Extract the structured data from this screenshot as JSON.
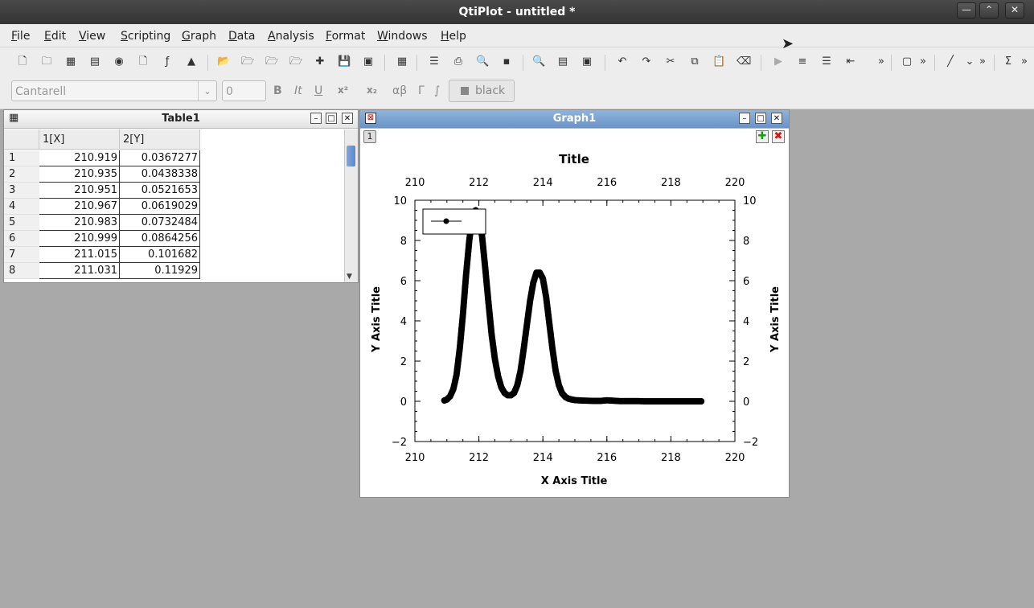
{
  "app": {
    "window_title": "QtiPlot - untitled *",
    "wm_buttons": [
      "—",
      "⌃",
      "✕"
    ]
  },
  "menu": [
    {
      "label": "File",
      "underline": "F",
      "rest": "ile"
    },
    {
      "label": "Edit",
      "underline": "E",
      "rest": "dit"
    },
    {
      "label": "View",
      "underline": "V",
      "rest": "iew"
    },
    {
      "label": "Scripting",
      "underline": "S",
      "rest": "cripting"
    },
    {
      "label": "Graph",
      "underline": "G",
      "rest": "raph"
    },
    {
      "label": "Data",
      "underline": "D",
      "rest": "ata"
    },
    {
      "label": "Analysis",
      "underline": "A",
      "rest": "nalysis"
    },
    {
      "label": "Format",
      "underline": "F",
      "rest": "ormat"
    },
    {
      "label": "Windows",
      "underline": "W",
      "rest": "indows"
    },
    {
      "label": "Help",
      "underline": "H",
      "rest": "elp"
    }
  ],
  "toolbar": {
    "overflow_labels": [
      "»",
      "»",
      "»",
      "»"
    ],
    "sigma": "Σ"
  },
  "format_toolbar": {
    "font_family": "Cantarell",
    "font_size": "0",
    "bold": "B",
    "italic": "It",
    "underline": "U",
    "superscript": "x²",
    "subscript": "x₂",
    "greek": "αβ",
    "greek_upper": "Γ",
    "integral": "∫",
    "color_label": "black"
  },
  "table_window": {
    "title": "Table1",
    "columns": [
      "1[X]",
      "2[Y]"
    ],
    "rows": [
      {
        "n": "1",
        "x": "210.919",
        "y": "0.0367277"
      },
      {
        "n": "2",
        "x": "210.935",
        "y": "0.0438338"
      },
      {
        "n": "3",
        "x": "210.951",
        "y": "0.0521653"
      },
      {
        "n": "4",
        "x": "210.967",
        "y": "0.0619029"
      },
      {
        "n": "5",
        "x": "210.983",
        "y": "0.0732484"
      },
      {
        "n": "6",
        "x": "210.999",
        "y": "0.0864256"
      },
      {
        "n": "7",
        "x": "211.015",
        "y": "0.101682"
      },
      {
        "n": "8",
        "x": "211.031",
        "y": "0.11929"
      }
    ]
  },
  "graph_window": {
    "title": "Graph1",
    "layer_label": "1"
  },
  "chart_data": {
    "type": "scatter",
    "title": "Title",
    "xlabel": "X Axis Title",
    "ylabel": "Y Axis Title",
    "right_ylabel": "Y Axis Title",
    "xlim": [
      210,
      220
    ],
    "ylim": [
      -2,
      10
    ],
    "xticks": [
      210,
      212,
      214,
      216,
      218,
      220
    ],
    "yticks": [
      -2,
      0,
      2,
      4,
      6,
      8,
      10
    ],
    "ytick_labels": [
      "−2",
      "0",
      "2",
      "4",
      "6",
      "8",
      "10"
    ],
    "grid": false,
    "legend": "top-left",
    "color": "#000000",
    "x": [
      210.92,
      211.0,
      211.1,
      211.2,
      211.3,
      211.4,
      211.5,
      211.6,
      211.7,
      211.8,
      211.9,
      212.0,
      212.1,
      212.2,
      212.3,
      212.4,
      212.5,
      212.6,
      212.7,
      212.8,
      212.9,
      213.0,
      213.1,
      213.2,
      213.3,
      213.4,
      213.5,
      213.6,
      213.7,
      213.8,
      213.9,
      214.0,
      214.1,
      214.2,
      214.3,
      214.4,
      214.5,
      214.6,
      214.7,
      214.8,
      214.9,
      215.0,
      215.2,
      215.4,
      215.6,
      215.8,
      216.0,
      216.2,
      216.4,
      216.6,
      216.8,
      217.0,
      217.2,
      217.4,
      217.6,
      217.8,
      218.0,
      218.2,
      218.4,
      218.6,
      218.8,
      218.95
    ],
    "y": [
      0.04,
      0.09,
      0.25,
      0.6,
      1.3,
      2.6,
      4.3,
      6.3,
      8.0,
      9.2,
      9.5,
      9.2,
      8.2,
      6.6,
      4.9,
      3.3,
      2.1,
      1.25,
      0.7,
      0.42,
      0.3,
      0.3,
      0.42,
      0.8,
      1.5,
      2.6,
      3.8,
      5.0,
      5.9,
      6.4,
      6.4,
      6.1,
      5.2,
      3.9,
      2.6,
      1.5,
      0.8,
      0.4,
      0.22,
      0.13,
      0.09,
      0.06,
      0.04,
      0.03,
      0.02,
      0.02,
      0.05,
      0.03,
      0.01,
      0.01,
      0.01,
      0.01,
      0.0,
      0.0,
      0.0,
      0.0,
      0.0,
      0.0,
      0.0,
      0.0,
      0.0,
      0.0
    ]
  }
}
